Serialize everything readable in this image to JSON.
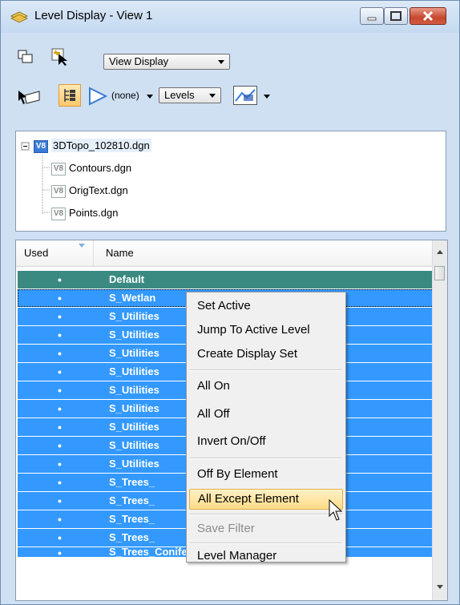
{
  "window": {
    "title": "Level Display - View 1"
  },
  "toolbar1": {
    "view_combo": "View Display"
  },
  "toolbar2": {
    "filter_label": "(none)",
    "levels_combo": "Levels"
  },
  "tree": [
    {
      "label": "3DTopo_102810.dgn",
      "icon": "V8"
    },
    {
      "label": "Contours.dgn",
      "icon": "V8"
    },
    {
      "label": "OrigText.dgn",
      "icon": "V8"
    },
    {
      "label": "Points.dgn",
      "icon": "V8"
    }
  ],
  "grid": {
    "headers": {
      "used": "Used",
      "name": "Name"
    },
    "rows": [
      {
        "used": "•",
        "name": "Default"
      },
      {
        "used": "•",
        "name": "S_Wetlan"
      },
      {
        "used": "•",
        "name": "S_Utilities"
      },
      {
        "used": "•",
        "name": "S_Utilities"
      },
      {
        "used": "•",
        "name": "S_Utilities"
      },
      {
        "used": "•",
        "name": "S_Utilities"
      },
      {
        "used": "•",
        "name": "S_Utilities"
      },
      {
        "used": "•",
        "name": "S_Utilities"
      },
      {
        "used": "•",
        "name": "S_Utilities"
      },
      {
        "used": "•",
        "name": "S_Utilities"
      },
      {
        "used": "•",
        "name": "S_Utilities"
      },
      {
        "used": "•",
        "name": "S_Trees_"
      },
      {
        "used": "•",
        "name": "S_Trees_"
      },
      {
        "used": "•",
        "name": "S_Trees_"
      },
      {
        "used": "•",
        "name": "S_Trees_"
      },
      {
        "used": "•",
        "name": "S_Trees_Conifer_Pav"
      }
    ]
  },
  "context_menu": {
    "items": [
      {
        "label": "Set Active",
        "state": "normal"
      },
      {
        "label": "Jump To Active Level",
        "state": "normal"
      },
      {
        "label": "Create Display Set",
        "state": "normal"
      },
      {
        "label": "All On",
        "state": "normal"
      },
      {
        "label": "All Off",
        "state": "normal"
      },
      {
        "label": "Invert On/Off",
        "state": "normal"
      },
      {
        "label": "Off By Element",
        "state": "normal"
      },
      {
        "label": "All Except Element",
        "state": "hover"
      },
      {
        "label": "Save Filter",
        "state": "disabled"
      },
      {
        "label": "Level Manager",
        "state": "normal"
      }
    ]
  },
  "colors": {
    "selection": "#3399ff",
    "default_row": "#3b8a82",
    "close_button": "#c6472d",
    "hover_highlight": "#ffdc88"
  }
}
